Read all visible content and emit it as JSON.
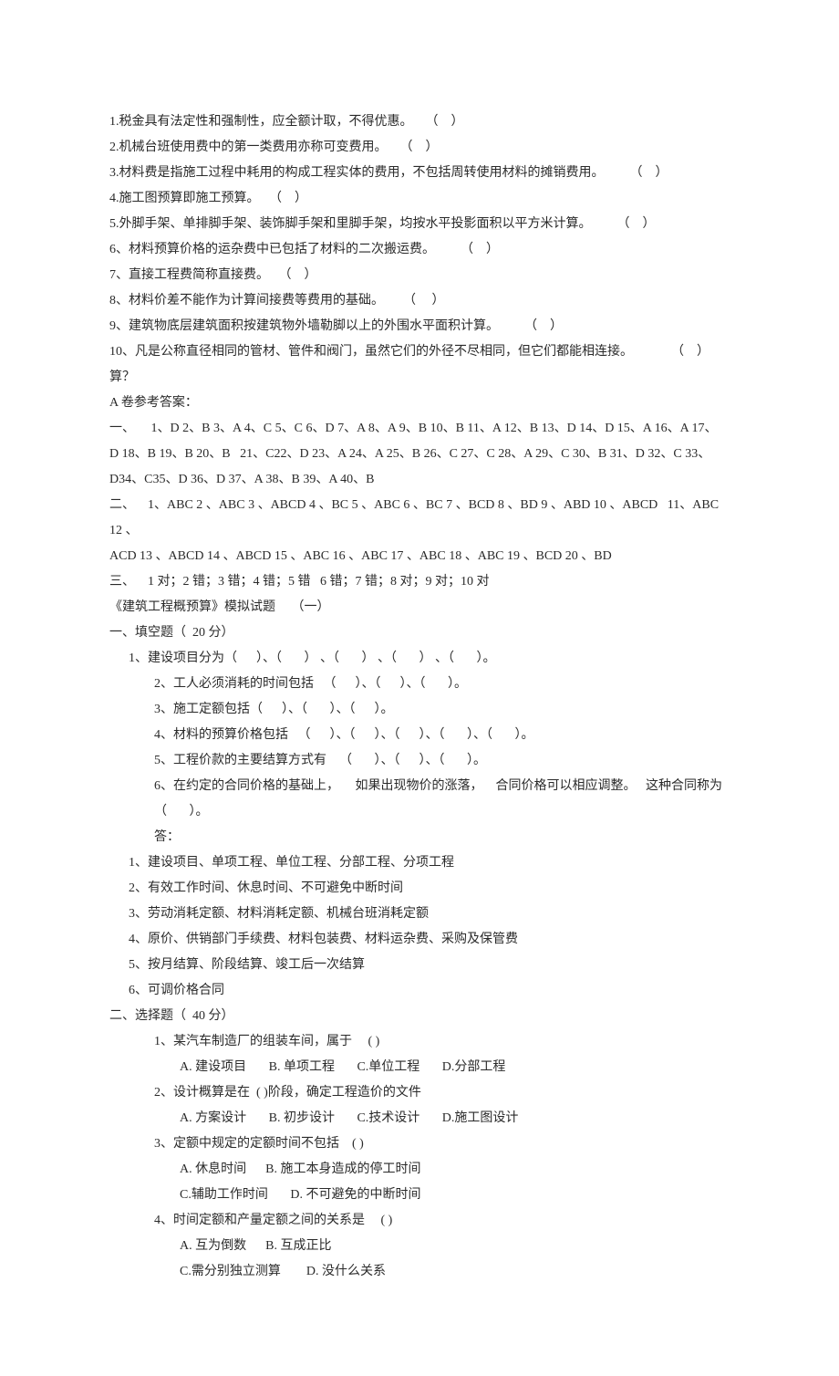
{
  "tf": [
    "1.税金具有法定性和强制性，应全额计取，不得优惠。    （    ）",
    "2.机械台班使用费中的第一类费用亦称可变费用。    （    ）",
    "3.材料费是指施工过程中耗用的构成工程实体的费用，不包括周转使用材料的摊销费用。        （    ）",
    "4.施工图预算即施工预算。   （    ）",
    "5.外脚手架、单排脚手架、装饰脚手架和里脚手架，均按水平投影面积以平方米计算。        （    ）",
    "6、材料预算价格的运杂费中已包括了材料的二次搬运费。        （    ）",
    "7、直接工程费简称直接费。   （    ）",
    "8、材料价差不能作为计算间接费等费用的基础。      （     ）",
    "9、建筑物底层建筑面积按建筑物外墙勒脚以上的外围水平面积计算。        （    ）",
    "10、凡是公称直径相同的管材、管件和阀门，虽然它们的外径不尽相同，但它们都能相连接。            （    ）",
    "算？"
  ],
  "ansTitle": "A 卷参考答案：",
  "ans": [
    "一、     1、D 2、B 3、A 4、C 5、C 6、D 7、A 8、A 9、B 10、B 11、A 12、B 13、D 14、D 15、A 16、A 17、",
    "D 18、B 19、B 20、B   21、C22、D 23、A 24、A 25、B 26、C 27、C 28、A 29、C 30、B 31、D 32、C 33、",
    "D34、C35、D 36、D 37、A 38、B 39、A 40、B",
    "二、    1、ABC 2 、ABC 3 、ABCD 4 、BC 5 、ABC 6 、BC 7 、BCD 8 、BD 9 、ABD 10 、ABCD   11、ABC 12 、",
    "ACD 13 、ABCD 14 、ABCD 15 、ABC 16 、ABC 17 、ABC 18 、ABC 19 、BCD 20 、BD",
    "三、    1 对；2 错；3 错；4 错；5 错   6 错；7 错；8 对；9 对；10 对"
  ],
  "title2": "《建筑工程概预算》模拟试题     （一）",
  "sec1Title": "一、填空题（  20 分）",
  "fill": [
    "1、建设项目分为（      ）、（       ） 、（       ） 、（       ） 、（       ）。",
    "2、工人必须消耗的时间包括   （      ）、（      ）、（       ）。",
    "3、施工定额包括（      ）、（       ）、（      ）。",
    "4、材料的预算价格包括   （      ）、（      ）、（      ）、（       ）、（       ）。",
    "5、工程价款的主要结算方式有    （       ）、（      ）、（       ）。",
    "6、在约定的合同价格的基础上，     如果出现物价的涨落，    合同价格可以相应调整。   这种合同称为（       ）。"
  ],
  "ansLabel": "答：",
  "fillAns": [
    "1、建设项目、单项工程、单位工程、分部工程、分项工程",
    "2、有效工作时间、休息时间、不可避免中断时间",
    "3、劳动消耗定额、材料消耗定额、机械台班消耗定额",
    "4、原价、供销部门手续费、材料包装费、材料运杂费、采购及保管费",
    "5、按月结算、阶段结算、竣工后一次结算",
    "6、可调价格合同"
  ],
  "sec2Title": "二、选择题（  40 分）",
  "mc": [
    {
      "q": "1、某汽车制造厂的组装车间，属于     ( )",
      "opts": [
        "A. 建设项目       B. 单项工程       C.单位工程       D.分部工程"
      ]
    },
    {
      "q": "2、设计概算是在  ( )阶段，确定工程造价的文件",
      "opts": [
        "A. 方案设计       B. 初步设计       C.技术设计       D.施工图设计"
      ]
    },
    {
      "q": "3、定额中规定的定额时间不包括    ( )",
      "opts": [
        "A. 休息时间      B. 施工本身造成的停工时间",
        "C.辅助工作时间       D. 不可避免的中断时间"
      ]
    },
    {
      "q": "4、时间定额和产量定额之间的关系是     ( )",
      "opts": [
        "A. 互为倒数      B. 互成正比",
        "C.需分别独立测算        D. 没什么关系"
      ]
    }
  ]
}
